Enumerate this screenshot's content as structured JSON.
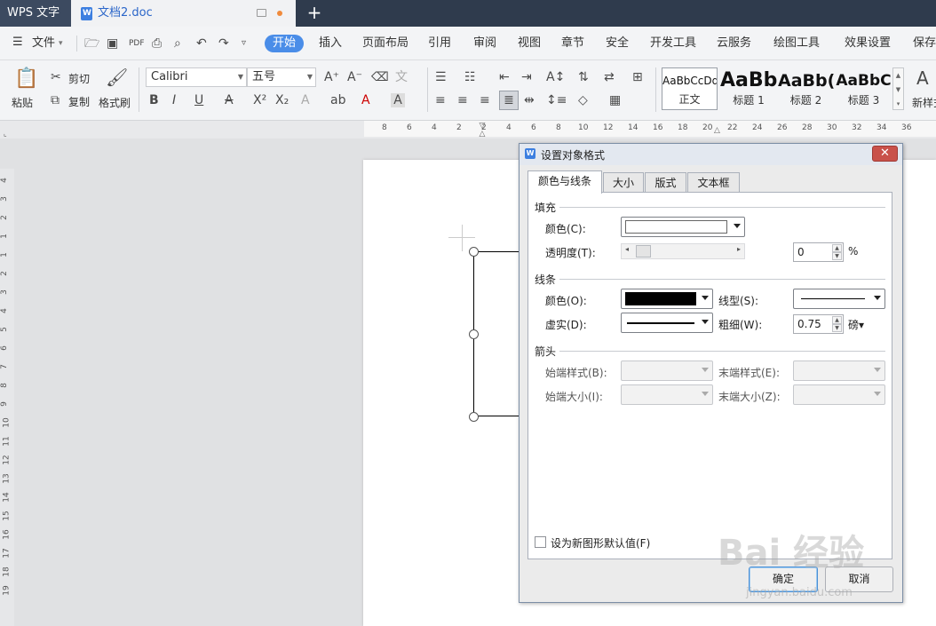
{
  "app": {
    "name": "WPS 文字",
    "doc_tab": "文档2.doc",
    "new_tab": "+"
  },
  "menu": {
    "file": "文件",
    "items": [
      "开始",
      "插入",
      "页面布局",
      "引用",
      "审阅",
      "视图",
      "章节",
      "安全",
      "开发工具",
      "云服务",
      "绘图工具",
      "效果设置",
      "保存"
    ]
  },
  "toolbar": {
    "paste": "粘贴",
    "cut": "剪切",
    "copy": "复制",
    "format_painter": "格式刷",
    "font_name": "Calibri",
    "font_size": "五号",
    "styles": [
      {
        "preview": "AaBbCcDd",
        "name": "正文"
      },
      {
        "preview": "AaBb",
        "name": "标题 1"
      },
      {
        "preview": "AaBb(",
        "name": "标题 2"
      },
      {
        "preview": "AaBbC",
        "name": "标题 3"
      }
    ],
    "new_style": "新样式"
  },
  "ruler": {
    "h_ticks": [
      "8",
      "6",
      "4",
      "2",
      "2",
      "4",
      "6",
      "8",
      "10",
      "12",
      "14",
      "16",
      "18",
      "20",
      "22",
      "24",
      "26",
      "28",
      "30",
      "32",
      "34",
      "36"
    ],
    "v_ticks": [
      "4",
      "3",
      "2",
      "1",
      "1",
      "2",
      "3",
      "4",
      "5",
      "6",
      "7",
      "8",
      "9",
      "10",
      "11",
      "12",
      "13",
      "14",
      "15",
      "16",
      "17",
      "18",
      "19"
    ]
  },
  "dialog": {
    "title": "设置对象格式",
    "tabs": [
      "颜色与线条",
      "大小",
      "版式",
      "文本框"
    ],
    "fill": {
      "section": "填充",
      "color_label": "颜色(C):",
      "color_value": "#ffffff",
      "transparency_label": "透明度(T):",
      "transparency_value": "0",
      "percent": "%"
    },
    "line": {
      "section": "线条",
      "color_label": "颜色(O):",
      "color_value": "#000000",
      "style_label": "线型(S):",
      "dash_label": "虚实(D):",
      "weight_label": "粗细(W):",
      "weight_value": "0.75",
      "weight_unit": "磅▾"
    },
    "arrow": {
      "section": "箭头",
      "begin_style": "始端样式(B):",
      "end_style": "末端样式(E):",
      "begin_size": "始端大小(I):",
      "end_size": "末端大小(Z):"
    },
    "default_checkbox": "设为新图形默认值(F)",
    "ok": "确定",
    "cancel": "取消"
  },
  "watermark": {
    "text": "Bai 经验",
    "url": "jingyan.baidu.com"
  }
}
